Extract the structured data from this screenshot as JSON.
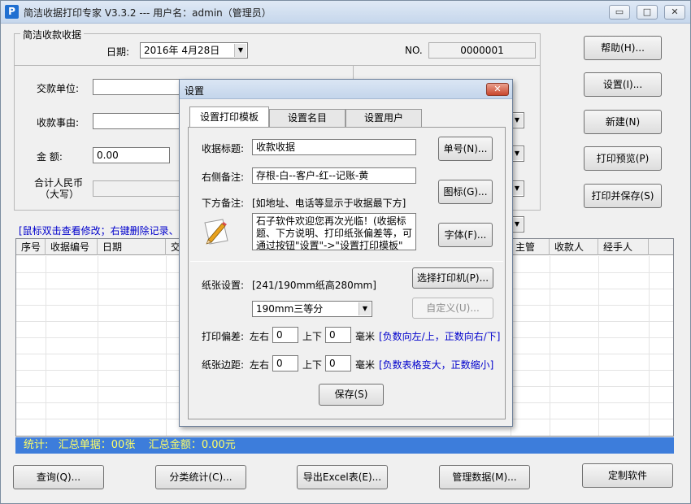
{
  "window": {
    "title": "简洁收据打印专家 V3.3.2 --- 用户名：admin（管理员）",
    "app_icon": "P",
    "minimize_glyph": "▭",
    "maximize_glyph": "□",
    "close_glyph": "✕"
  },
  "form": {
    "group_title": "简洁收款收据",
    "date_label": "日期:",
    "date_value": "2016年  4月28日",
    "no_label": "NO.",
    "no_value": "0000001",
    "payer_label": "交款单位:",
    "reason_label": "收款事由:",
    "amount_label": "金    额:",
    "amount_value": "0.00",
    "rmb_label_1": "合计人民币",
    "rmb_label_2": "（大写）"
  },
  "right_buttons": {
    "help": "帮助(H)...",
    "settings": "设置(I)...",
    "new": "新建(N)",
    "preview": "打印预览(P)",
    "print_save": "打印并保存(S)"
  },
  "hint": "[鼠标双击查看修改；右键删除记录、",
  "grid": {
    "columns": [
      "序号",
      "收据编号",
      "日期",
      "交",
      "主管",
      "收款人",
      "经手人"
    ]
  },
  "status": {
    "text": "统计:   汇总单据：00张    汇总金额：0.00元"
  },
  "bottom_buttons": {
    "query": "查询(Q)...",
    "category": "分类统计(C)...",
    "export": "导出Excel表(E)...",
    "manage": "管理数据(M)...",
    "custom": "定制软件"
  },
  "dialog": {
    "title": "设置",
    "close_glyph": "✕",
    "tabs": [
      "设置打印模板",
      "设置名目",
      "设置用户"
    ],
    "receipt_title_label": "收据标题:",
    "receipt_title_value": "收款收据",
    "right_note_label": "右侧备注:",
    "right_note_value": "存根-白--客户-红--记账-黄",
    "bottom_note_label": "下方备注:",
    "bottom_note_hint": "[如地址、电话等显示于收据最下方]",
    "bottom_note_value": "石子软件欢迎您再次光临！(收据标题、下方说明、打印纸张偏差等，可通过按钮\"设置\"->\"设置打印模板\"",
    "number_button": "单号(N)...",
    "icon_button": "图标(G)...",
    "font_button": "字体(F)...",
    "paper_label": "纸张设置:",
    "paper_info": "[241/190mm纸高280mm]",
    "printer_button": "选择打印机(P)...",
    "paper_select": "190mm三等分",
    "custom_button": "自定义(U)...",
    "offset_label": "打印偏差:",
    "lr_label": "左右",
    "ud_label": "上下",
    "offset_lr": "0",
    "offset_ud": "0",
    "mm_label": "毫米",
    "offset_hint": "[负数向左/上，正数向右/下]",
    "margin_label": "纸张边距:",
    "margin_lr": "0",
    "margin_ud": "0",
    "margin_hint": "[负数表格变大，正数缩小]",
    "save_button": "保存(S)"
  }
}
